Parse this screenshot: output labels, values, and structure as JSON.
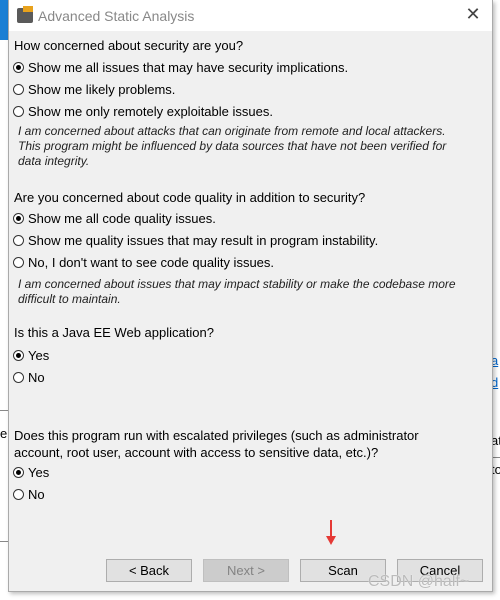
{
  "window": {
    "title": "Advanced Static Analysis"
  },
  "sections": [
    {
      "question": "How concerned about security are you?",
      "options": [
        {
          "label": "Show me all issues that may have security implications.",
          "selected": true
        },
        {
          "label": "Show me likely problems.",
          "selected": false
        },
        {
          "label": "Show me only remotely exploitable issues.",
          "selected": false
        }
      ],
      "description": "I am concerned about attacks that can originate from remote and local attackers. This program might be influenced by data sources that have not been verified for data integrity."
    },
    {
      "question": "Are you concerned about code quality in addition to security?",
      "options": [
        {
          "label": "Show me all code quality issues.",
          "selected": true
        },
        {
          "label": "Show me quality issues that may result in program instability.",
          "selected": false
        },
        {
          "label": "No, I don't want to see code quality issues.",
          "selected": false
        }
      ],
      "description": "I am concerned about issues that may impact stability or make the codebase more difficult to maintain."
    },
    {
      "question": "Is this a Java EE Web application?",
      "options": [
        {
          "label": "Yes",
          "selected": true
        },
        {
          "label": "No",
          "selected": false
        }
      ]
    },
    {
      "question": "Does this program run with escalated privileges (such as administrator account, root user, account with access to sensitive data, etc.)?",
      "options": [
        {
          "label": "Yes",
          "selected": true
        },
        {
          "label": "No",
          "selected": false
        }
      ]
    }
  ],
  "buttons": {
    "back": "< Back",
    "next": "Next >",
    "scan": "Scan",
    "cancel": "Cancel"
  },
  "background_fragments": [
    "a",
    "d",
    "er",
    "at",
    "to"
  ],
  "watermark": "CSDN @half~",
  "colors": {
    "annotation_arrow": "#e53935",
    "link": "#0066cc"
  }
}
